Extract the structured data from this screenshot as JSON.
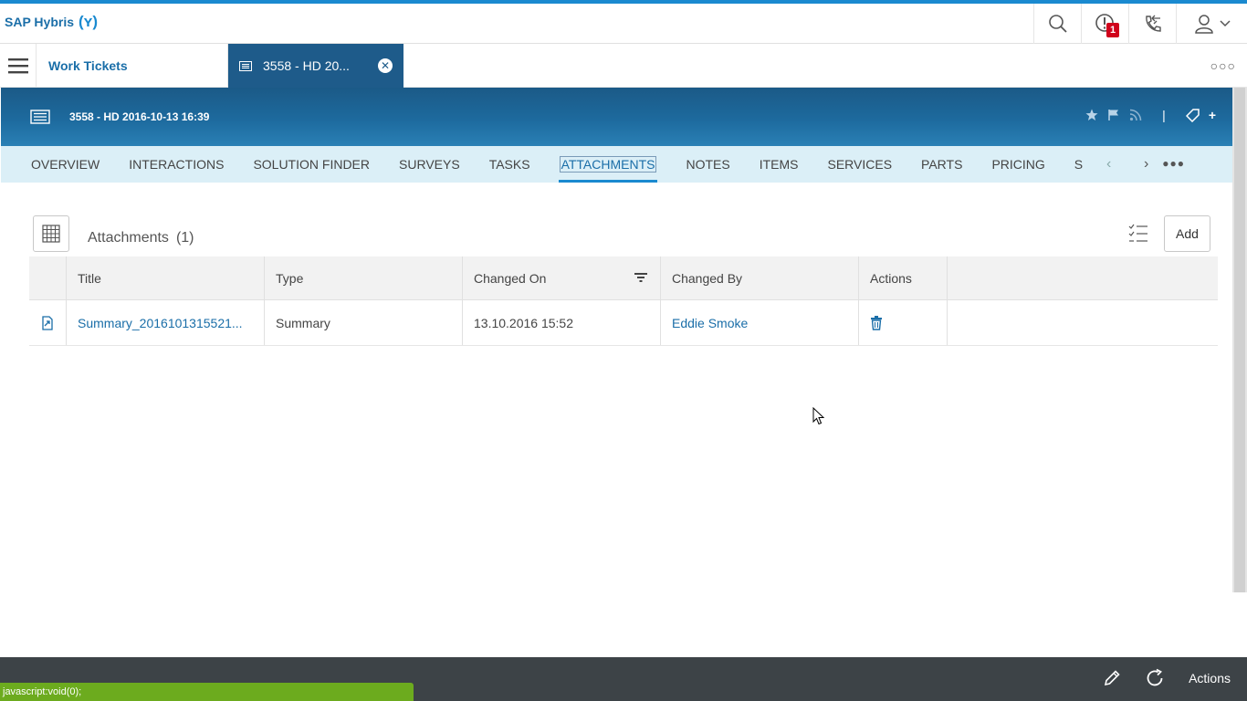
{
  "shell": {
    "brand": "SAP Hybris",
    "brand_mark": "(ʏ)",
    "notification_count": "1"
  },
  "tabs": {
    "work_tickets": "Work Tickets",
    "active_tab": "3558 - HD 20..."
  },
  "object": {
    "title": "3558 - HD 2016-10-13 16:39",
    "add_label": "+"
  },
  "section_tabs": [
    "OVERVIEW",
    "INTERACTIONS",
    "SOLUTION FINDER",
    "SURVEYS",
    "TASKS",
    "ATTACHMENTS",
    "NOTES",
    "ITEMS",
    "SERVICES",
    "PARTS",
    "PRICING",
    "S"
  ],
  "attachments": {
    "title": "Attachments",
    "count": "(1)",
    "add_label": "Add",
    "columns": [
      "Title",
      "Type",
      "Changed On",
      "Changed By",
      "Actions"
    ],
    "rows": [
      {
        "title": "Summary_2016101315521...",
        "type": "Summary",
        "changed_on": "13.10.2016 15:52",
        "changed_by": "Eddie Smoke"
      }
    ]
  },
  "bottom": {
    "actions_label": "Actions",
    "status_text": "javascript:void(0);"
  },
  "colors": {
    "accent": "#1a8ad0",
    "header_dark": "#1b5a87",
    "tab_strip": "#dbeff7",
    "footer": "#3d4347",
    "status_bar": "#6cab1e",
    "badge": "#d0021b"
  }
}
